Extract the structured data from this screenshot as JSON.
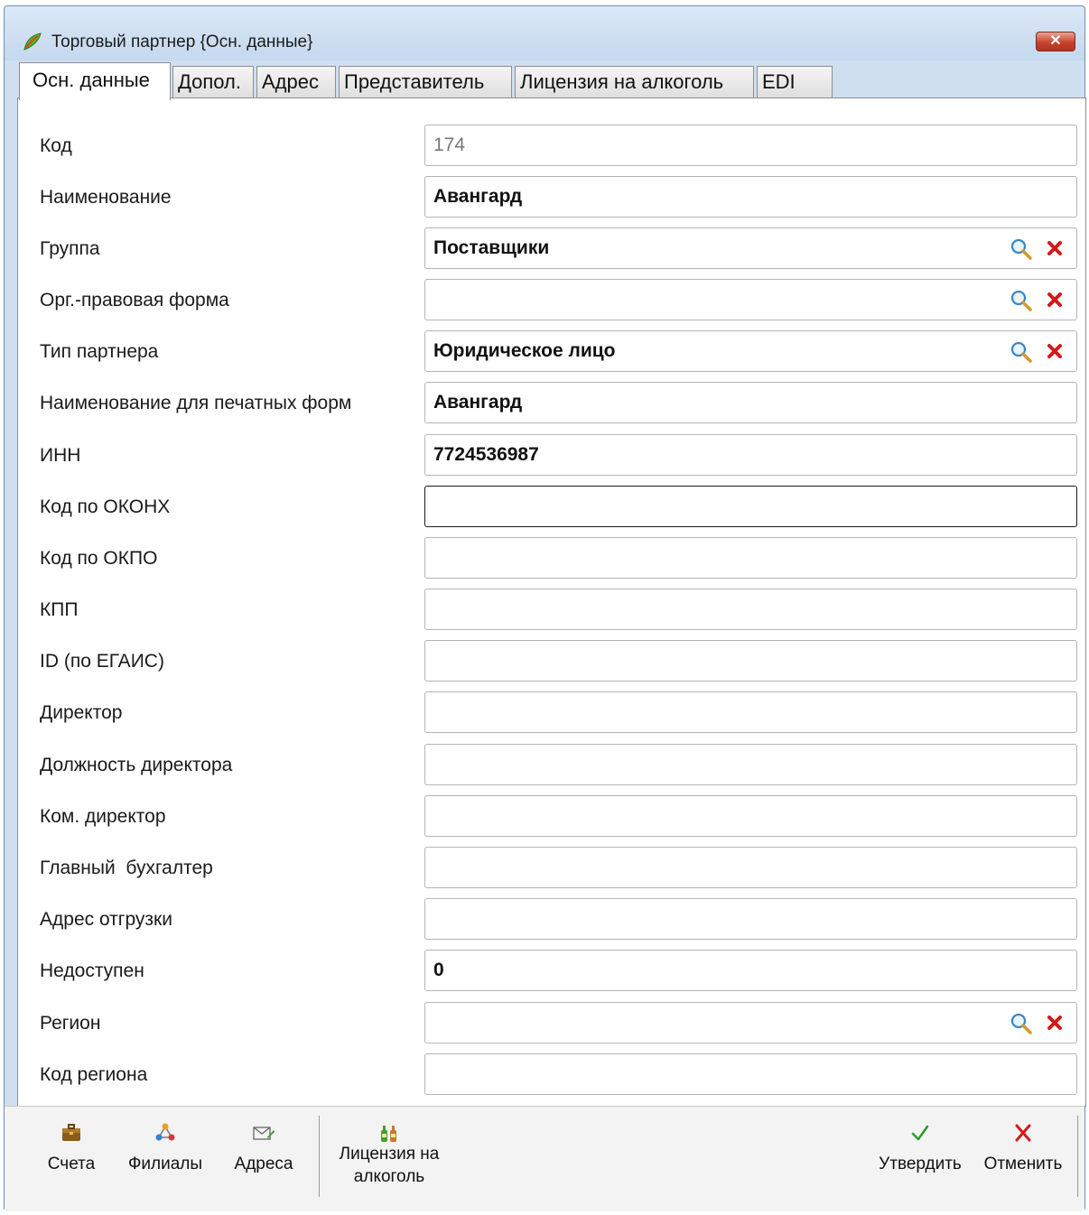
{
  "window": {
    "title": "Торговый партнер {Осн. данные}",
    "app_icon": "leaf-icon",
    "close_icon": "close-icon"
  },
  "tabs": [
    {
      "label": "Осн. данные",
      "active": true
    },
    {
      "label": "Допол.",
      "active": false
    },
    {
      "label": "Адрес",
      "active": false
    },
    {
      "label": "Представитель",
      "active": false
    },
    {
      "label": "Лицензия на алкоголь",
      "active": false
    },
    {
      "label": "EDI",
      "active": false
    }
  ],
  "form": {
    "fields": [
      {
        "label": "Код",
        "value": "174",
        "readonly": true
      },
      {
        "label": "Наименование",
        "value": "Авангард"
      },
      {
        "label": "Группа",
        "value": "Поставщики",
        "lookup": true
      },
      {
        "label": "Орг.-правовая форма",
        "value": "",
        "lookup": true
      },
      {
        "label": "Тип партнера",
        "value": "Юридическое лицо",
        "lookup": true
      },
      {
        "label": "Наименование для печатных форм",
        "value": "Авангард"
      },
      {
        "label": "ИНН",
        "value": "7724536987"
      },
      {
        "label": "Код по ОКОНХ",
        "value": "",
        "focused": true
      },
      {
        "label": "Код по ОКПО",
        "value": ""
      },
      {
        "label": "КПП",
        "value": ""
      },
      {
        "label": "ID (по ЕГАИС)",
        "value": ""
      },
      {
        "label": "Директор",
        "value": ""
      },
      {
        "label": "Должность директора",
        "value": ""
      },
      {
        "label": "Ком. директор",
        "value": ""
      },
      {
        "label": "Главный  бухгалтер",
        "value": ""
      },
      {
        "label": "Адрес отгрузки",
        "value": ""
      },
      {
        "label": "Недоступен",
        "value": "0"
      },
      {
        "label": "Регион",
        "value": "",
        "lookup": true
      },
      {
        "label": "Код региона",
        "value": ""
      }
    ]
  },
  "toolbar": {
    "accounts_label": "Счета",
    "branches_label": "Филиалы",
    "addresses_label": "Адреса",
    "license_label": "Лицензия на алкоголь",
    "confirm_label": "Утвердить",
    "cancel_label": "Отменить"
  },
  "colors": {
    "window_frame": "#cfdff0",
    "close_button": "#c8432c",
    "confirm_check": "#2e9a2e",
    "cancel_cross": "#d11a1a"
  }
}
